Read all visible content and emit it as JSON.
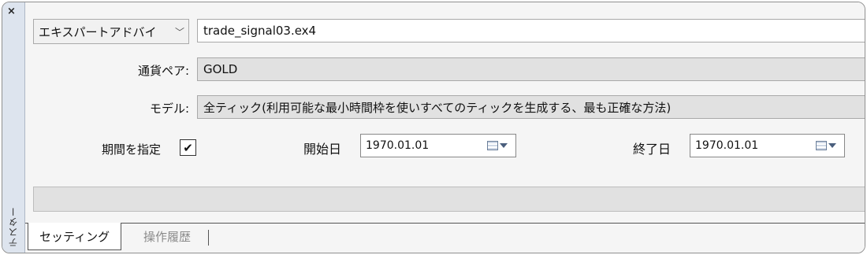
{
  "sidebar": {
    "close": "×",
    "title": "テスター"
  },
  "tester": {
    "type_dropdown": {
      "value": "エキスパートアドバイ",
      "chevron": "﹀"
    },
    "ea_file": "trade_signal03.ex4",
    "symbol_label": "通貨ペア:",
    "symbol_value": "GOLD",
    "model_label": "モデル:",
    "model_value": "全ティック(利用可能な最小時間枠を使いすべてのティックを生成する、最も正確な方法)",
    "use_period_label": "期間を指定",
    "use_period_checked": true,
    "checkmark": "✔",
    "start_label": "開始日",
    "start_value": "1970.01.01",
    "end_label": "終了日",
    "end_value": "1970.01.01",
    "progress": 0
  },
  "tabs": [
    {
      "label": "セッティング",
      "active": true
    },
    {
      "label": "操作履歴",
      "active": false
    }
  ],
  "icons": {
    "calendar": "calendar-icon",
    "dropdown": "dropdown-arrow-icon",
    "close": "close-icon"
  }
}
